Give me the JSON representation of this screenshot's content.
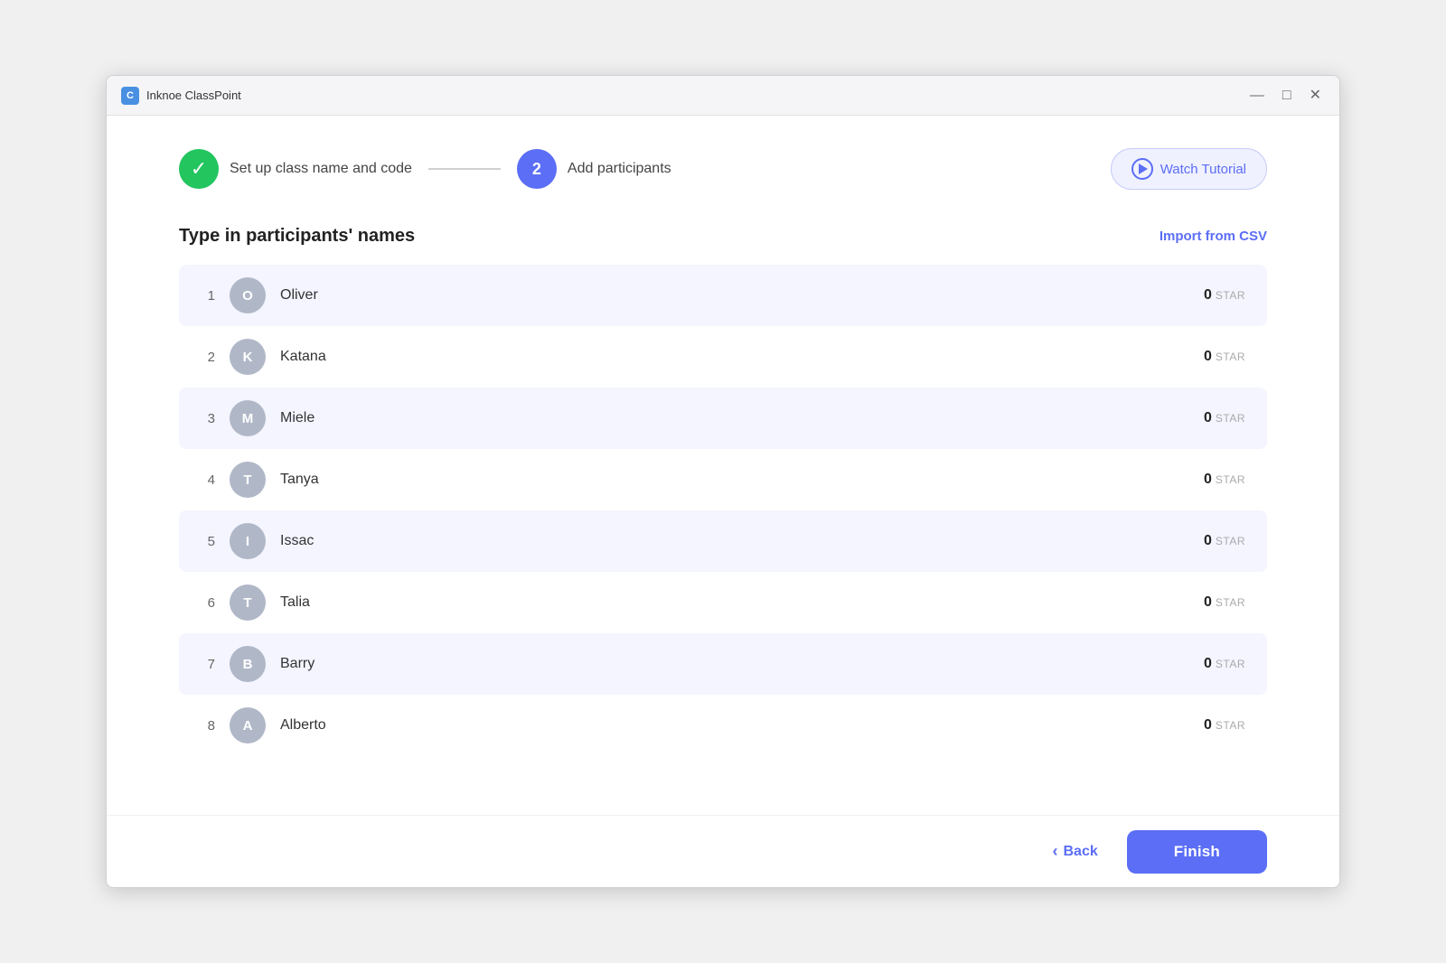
{
  "window": {
    "title": "Inknoe ClassPoint",
    "app_icon_label": "C",
    "controls": {
      "minimize": "—",
      "maximize": "□",
      "close": "✕"
    }
  },
  "stepper": {
    "step1": {
      "label": "Set up class name and code",
      "status": "done"
    },
    "step2": {
      "number": "2",
      "label": "Add participants",
      "status": "active"
    },
    "watch_tutorial_label": "Watch Tutorial"
  },
  "section": {
    "title": "Type in participants' names",
    "import_csv_label": "Import from CSV"
  },
  "participants": [
    {
      "number": "1",
      "initial": "O",
      "name": "Oliver",
      "stars": "0"
    },
    {
      "number": "2",
      "initial": "K",
      "name": "Katana",
      "stars": "0"
    },
    {
      "number": "3",
      "initial": "M",
      "name": "Miele",
      "stars": "0"
    },
    {
      "number": "4",
      "initial": "T",
      "name": "Tanya",
      "stars": "0"
    },
    {
      "number": "5",
      "initial": "I",
      "name": "Issac",
      "stars": "0"
    },
    {
      "number": "6",
      "initial": "T",
      "name": "Talia",
      "stars": "0"
    },
    {
      "number": "7",
      "initial": "B",
      "name": "Barry",
      "stars": "0"
    },
    {
      "number": "8",
      "initial": "A",
      "name": "Alberto",
      "stars": "0"
    }
  ],
  "star_label": "STAR",
  "nav": {
    "back_label": "Back",
    "finish_label": "Finish"
  }
}
